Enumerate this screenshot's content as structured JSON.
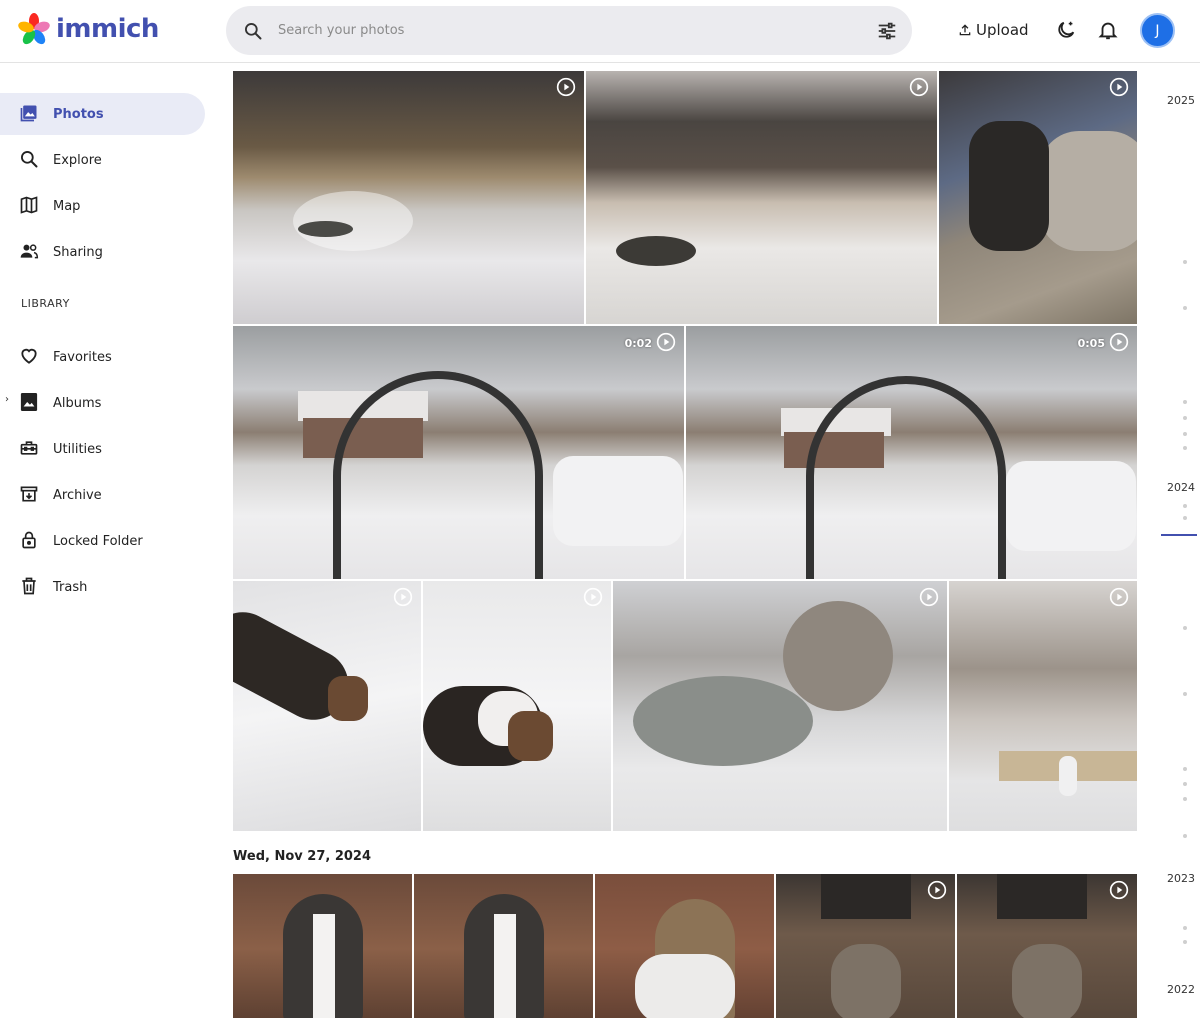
{
  "app": {
    "name": "immich"
  },
  "header": {
    "search_placeholder": "Search your photos",
    "upload_label": "Upload",
    "avatar_initial": "J"
  },
  "sidebar": {
    "items": [
      {
        "label": "Photos",
        "icon": "photos-icon",
        "active": true
      },
      {
        "label": "Explore",
        "icon": "search-icon"
      },
      {
        "label": "Map",
        "icon": "map-icon"
      },
      {
        "label": "Sharing",
        "icon": "people-icon"
      }
    ],
    "library_heading": "LIBRARY",
    "library_items": [
      {
        "label": "Favorites",
        "icon": "heart-icon"
      },
      {
        "label": "Albums",
        "icon": "album-icon"
      },
      {
        "label": "Utilities",
        "icon": "toolbox-icon"
      },
      {
        "label": "Archive",
        "icon": "archive-icon"
      },
      {
        "label": "Locked Folder",
        "icon": "lock-icon"
      },
      {
        "label": "Trash",
        "icon": "trash-icon"
      }
    ]
  },
  "grid": {
    "videos": [
      {
        "duration": "0:02"
      },
      {
        "duration": "0:05"
      }
    ],
    "date_heading": "Wed, Nov 27, 2024"
  },
  "timeline": {
    "years": [
      "2025",
      "2024",
      "2023",
      "2022"
    ]
  },
  "colors": {
    "accent": "#4250af",
    "active_bg": "#e9ebf6",
    "search_bg": "#ebebef",
    "avatar_bg": "#1e6fe6"
  }
}
